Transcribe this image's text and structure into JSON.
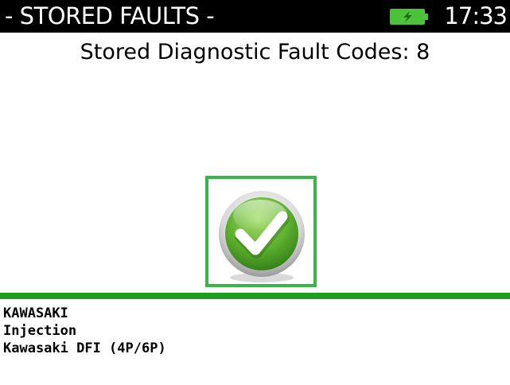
{
  "header": {
    "title": "- STORED FAULTS -",
    "clock": "17:33",
    "battery_icon": "battery-charging-icon"
  },
  "summary": {
    "label": "Stored Diagnostic Fault Codes: 8"
  },
  "status": {
    "icon": "checkmark-icon",
    "accent_color": "#39b54a"
  },
  "vehicle": {
    "make": "KAWASAKI",
    "system": "Injection",
    "model": "Kawasaki DFI (4P/6P)"
  },
  "colors": {
    "header_bg": "#000000",
    "header_fg": "#ffffff",
    "divider": "#1e9e1e",
    "battery": "#4cc13a"
  }
}
